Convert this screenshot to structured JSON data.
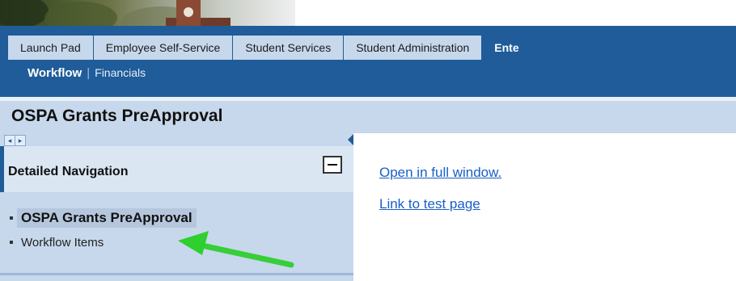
{
  "tabs": [
    {
      "label": "Launch Pad"
    },
    {
      "label": "Employee Self-Service"
    },
    {
      "label": "Student Services"
    },
    {
      "label": "Student Administration"
    },
    {
      "label": "Ente",
      "active": true
    }
  ],
  "subnav": {
    "current": "Workflow",
    "separator": "|",
    "other": "Financials"
  },
  "page": {
    "title": "OSPA Grants PreApproval"
  },
  "navigation": {
    "header": "Detailed Navigation",
    "items": [
      {
        "label": "OSPA Grants PreApproval",
        "selected": true
      },
      {
        "label": "Workflow Items",
        "selected": false
      }
    ]
  },
  "content": {
    "links": [
      {
        "label": "Open in full window."
      },
      {
        "label": "Link to test page"
      }
    ]
  },
  "colors": {
    "nav_blue": "#1f5c99",
    "light_blue": "#c7d8ec",
    "link_blue": "#1a5fc4",
    "annotation_green": "#33e033"
  },
  "icons": {
    "pager_prev": "◂",
    "pager_next": "▸",
    "collapse": "triangle-left",
    "minimize": "minus-box"
  }
}
